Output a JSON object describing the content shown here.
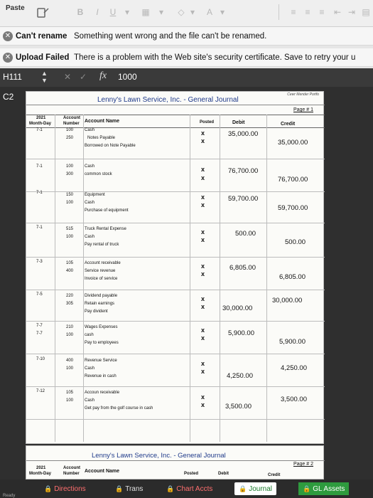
{
  "toolbar": {
    "paste_label": "Paste",
    "bold": "B",
    "italic": "I",
    "underline": "U"
  },
  "banners": [
    {
      "title": "Can't rename",
      "message": "Something went wrong and the file can't be renamed."
    },
    {
      "title": "Upload Failed",
      "message": "There is a problem with the Web site's security certificate. Save to retry your u"
    }
  ],
  "formula_bar": {
    "cell_ref": "H111",
    "fx": "fx",
    "value": "1000"
  },
  "sheet": {
    "cell_ref_2": "C2",
    "header_right": "Cewr Mender Portfo",
    "title": "Lenny's Lawn Service, Inc.  -  General Journal",
    "page": "Page # 1",
    "col_headers": {
      "year": "2021",
      "month_day": "Month-Day",
      "account_hdr": "Account",
      "number_hdr": "Number",
      "account_name": "Account Name",
      "posted": "Posted",
      "debit": "Debit",
      "credit": "Credit"
    },
    "entries": [
      {
        "date": "7-1",
        "num1": "100",
        "num2": "250",
        "acct1": "Cash",
        "acct2": "Notes Payable",
        "memo": "Borrowed on Note Payable",
        "debit": "35,000.00",
        "credit": "35,000.00",
        "posted": "x"
      },
      {
        "date": "7-1",
        "num1": "100",
        "num2": "300",
        "acct1": "Cash",
        "acct2": "common stock",
        "memo": "",
        "debit": "76,700.00",
        "credit": "76,700.00",
        "posted": "x"
      },
      {
        "date": "7-1",
        "num1": "150",
        "num2": "100",
        "acct1": "Equipment",
        "acct2": "Cash",
        "memo": "Purchase of equipment",
        "debit": "59,700.00",
        "credit": "59,700.00",
        "posted": "x"
      },
      {
        "date": "7-1",
        "num1": "515",
        "num2": "100",
        "acct1": "Truck Rental Expense",
        "acct2": "Cash",
        "memo": "Pay rental of truck",
        "debit": "500.00",
        "credit": "500.00",
        "posted": "x"
      },
      {
        "date": "7-3",
        "num1": "105",
        "num2": "400",
        "acct1": "Account receivable",
        "acct2": "Service revenue",
        "memo": "Invoice of service",
        "debit": "6,805.00",
        "credit": "6,805.00",
        "posted": "x"
      },
      {
        "date": "7-5",
        "num1": "220",
        "num2": "305",
        "acct1": "Dividend payable",
        "acct2": "Retain earnings",
        "memo": "Pay divident",
        "debit": "30,000.00",
        "credit": "30,000.00",
        "posted": "x"
      },
      {
        "date": "7-7",
        "date2": "7-7",
        "num1": "210",
        "num2": "100",
        "acct1": "Wages Expenses",
        "acct2": "cash",
        "memo": "Pay to employees",
        "debit": "5,900.00",
        "credit": "5,900.00",
        "posted": "x"
      },
      {
        "date": "7-10",
        "num1": "400",
        "num2": "100",
        "acct1": "Revenue Service",
        "acct2": "Cash",
        "memo": "Revenue in cash",
        "debit": "4,250.00",
        "credit": "4,250.00",
        "posted": "x"
      },
      {
        "date": "7-12",
        "num1": "105",
        "num2": "100",
        "acct1": "Accoun receivable",
        "acct2": "Cash",
        "memo": "Get pay from the golf course in cash",
        "debit": "3,500.00",
        "credit": "3,500.00",
        "posted": "x"
      }
    ],
    "page2": {
      "title": "Lenny's Lawn Service, Inc.  -  General Journal",
      "page": "Page # 2",
      "year": "2021",
      "month_day": "Month-Day",
      "account_hdr": "Account",
      "number_hdr": "Number",
      "account_name": "Account Name",
      "posted": "Posted",
      "debit": "Debit",
      "credit": "Credit"
    }
  },
  "tabs": [
    {
      "label": "Directions"
    },
    {
      "label": "Trans"
    },
    {
      "label": "Chart Accts"
    },
    {
      "label": "Journal"
    },
    {
      "label": "GL Assets"
    }
  ],
  "status": "Ready"
}
